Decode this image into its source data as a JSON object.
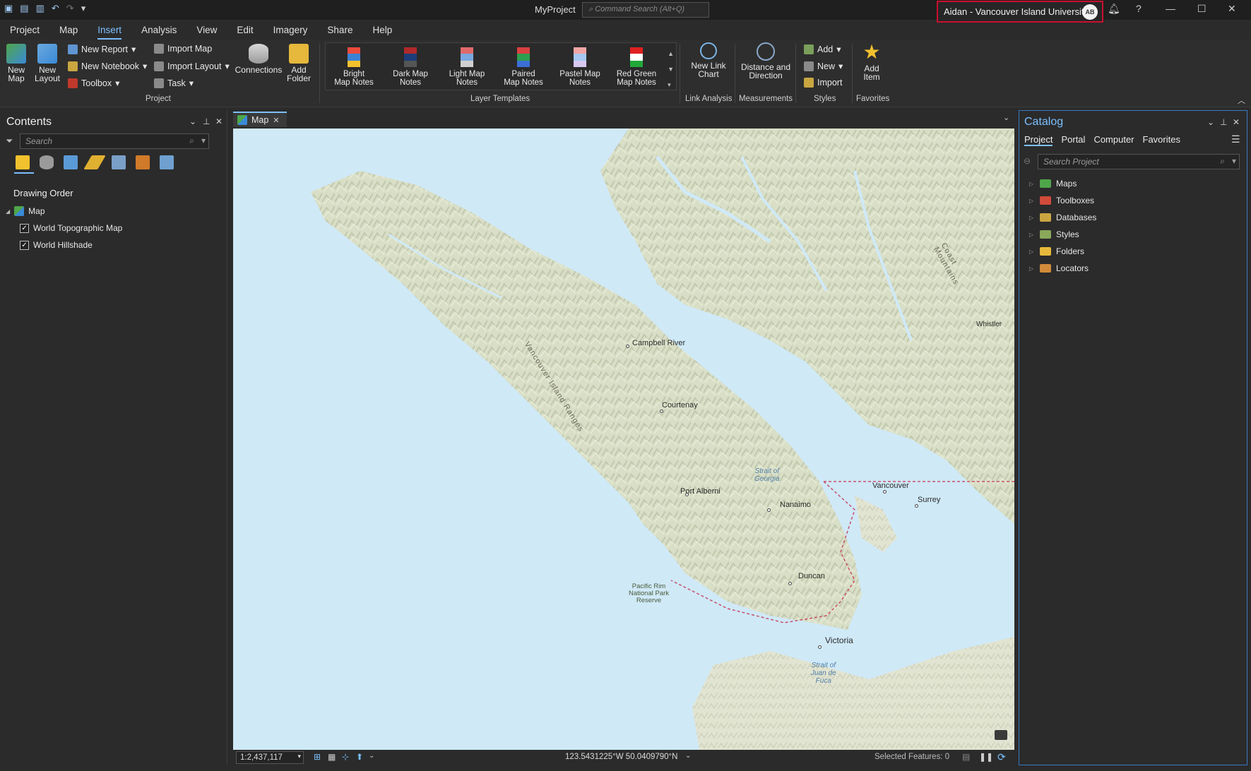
{
  "title_bar": {
    "app_title": "MyProject",
    "command_search_placeholder": "Command Search (Alt+Q)",
    "user_name": "Aidan - Vancouver Island University",
    "user_initials": "AB"
  },
  "menu": {
    "tabs": [
      "Project",
      "Map",
      "Insert",
      "Analysis",
      "View",
      "Edit",
      "Imagery",
      "Share",
      "Help"
    ],
    "active": "Insert"
  },
  "ribbon": {
    "project_group": {
      "new_map": "New Map",
      "new_layout": "New Layout",
      "new_report": "New Report",
      "new_notebook": "New Notebook",
      "toolbox": "Toolbox",
      "import_map": "Import Map",
      "import_layout": "Import Layout",
      "task": "Task",
      "connections": "Connections",
      "add_folder": "Add Folder",
      "label": "Project"
    },
    "layer_templates": {
      "label": "Layer Templates",
      "items": [
        {
          "line1": "Bright",
          "line2": "Map Notes"
        },
        {
          "line1": "Dark Map",
          "line2": "Notes"
        },
        {
          "line1": "Light Map",
          "line2": "Notes"
        },
        {
          "line1": "Paired",
          "line2": "Map Notes"
        },
        {
          "line1": "Pastel Map",
          "line2": "Notes"
        },
        {
          "line1": "Red Green",
          "line2": "Map Notes"
        }
      ]
    },
    "link_analysis": {
      "button_line1": "New Link",
      "button_line2": "Chart",
      "label": "Link Analysis"
    },
    "measurements": {
      "button_line1": "Distance and",
      "button_line2": "Direction",
      "label": "Measurements"
    },
    "styles": {
      "add": "Add",
      "new": "New",
      "import": "Import",
      "label": "Styles"
    },
    "favorites": {
      "button_line1": "Add",
      "button_line2": "Item",
      "label": "Favorites"
    }
  },
  "contents": {
    "title": "Contents",
    "search_placeholder": "Search",
    "drawing_order": "Drawing Order",
    "map_name": "Map",
    "layers": [
      {
        "name": "World Topographic Map",
        "checked": true
      },
      {
        "name": "World Hillshade",
        "checked": true
      }
    ]
  },
  "map_view": {
    "tab_label": "Map",
    "places": {
      "campbell_river": "Campbell River",
      "courtenay": "Courtenay",
      "port_alberni": "Port Alberni",
      "nanaimo": "Nanaimo",
      "duncan": "Duncan",
      "victoria": "Victoria",
      "vancouver": "Vancouver",
      "surrey": "Surrey",
      "whistler": "Whistler"
    },
    "water": {
      "georgia_1": "Strait of",
      "georgia_2": "Georgia",
      "juan_1": "Strait of",
      "juan_2": "Juan de",
      "juan_3": "Fuca"
    },
    "park": {
      "line1": "Pacific Rim",
      "line2": "National Park",
      "line3": "Reserve"
    },
    "ranges": {
      "island": "Vancouver Island Ranges",
      "coast": "Coast Mountains"
    }
  },
  "status_bar": {
    "scale": "1:2,437,117",
    "coordinates": "123.5431225°W 50.0409790°N",
    "selected_features": "Selected Features: 0"
  },
  "catalog": {
    "title": "Catalog",
    "tabs": [
      "Project",
      "Portal",
      "Computer",
      "Favorites"
    ],
    "active_tab": "Project",
    "search_placeholder": "Search Project",
    "items": [
      "Maps",
      "Toolboxes",
      "Databases",
      "Styles",
      "Folders",
      "Locators"
    ]
  }
}
